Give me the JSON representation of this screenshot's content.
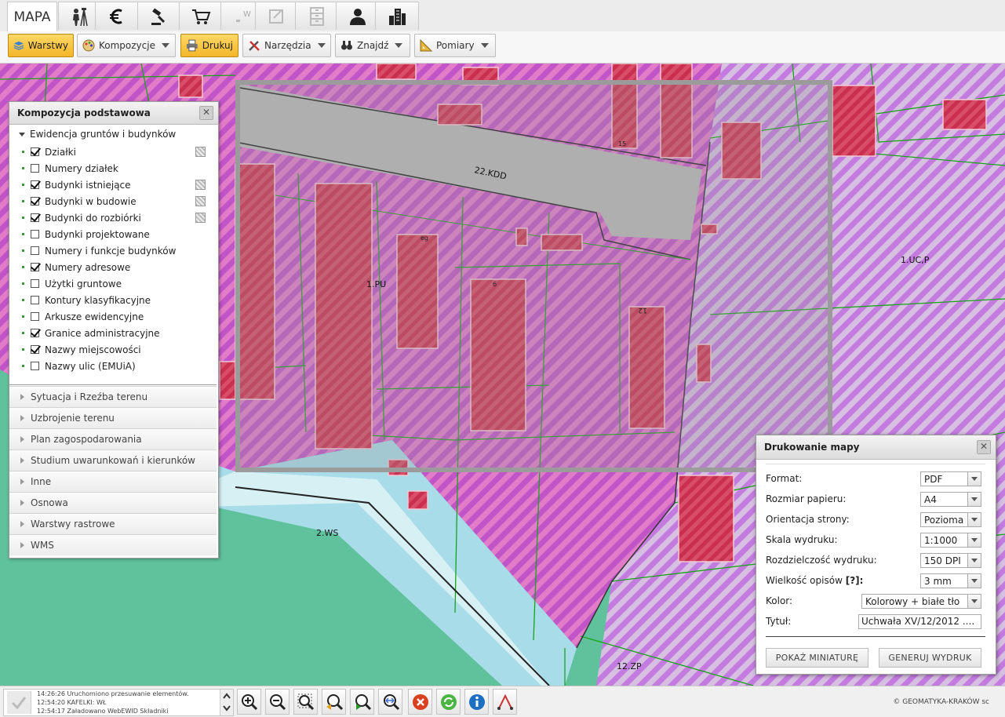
{
  "tabs": {
    "map_label": "MAPA"
  },
  "toolbar": {
    "warstwy": "Warstwy",
    "kompozycje": "Kompozycje",
    "drukuj": "Drukuj",
    "narzedzia": "Narzędzia",
    "znajdz": "Znajdź",
    "pomiary": "Pomiary"
  },
  "map": {
    "labels": [
      "22.KDD",
      "1.PU",
      "1.UC,P",
      "2.WS",
      "12.ZP",
      "12",
      "15",
      "eg",
      "6"
    ],
    "colors": {
      "zone_magenta": "#d65ad2",
      "zone_lilac": "#cf9be3",
      "water_green": "#63c4a0",
      "road_grey": "#b8b8b8",
      "building_red": "#c42b4f",
      "parcel_line": "#1aa31a"
    }
  },
  "layers_panel": {
    "title": "Kompozycja podstawowa",
    "group_title": "Ewidencja gruntów i budynków",
    "items": [
      {
        "label": "Działki",
        "checked": true,
        "legend": true
      },
      {
        "label": "Numery działek",
        "checked": false,
        "legend": false
      },
      {
        "label": "Budynki istniejące",
        "checked": true,
        "legend": true
      },
      {
        "label": "Budynki w budowie",
        "checked": true,
        "legend": true
      },
      {
        "label": "Budynki do rozbiórki",
        "checked": true,
        "legend": true
      },
      {
        "label": "Budynki projektowane",
        "checked": false,
        "legend": false
      },
      {
        "label": "Numery i funkcje budynków",
        "checked": false,
        "legend": false
      },
      {
        "label": "Numery adresowe",
        "checked": true,
        "legend": false
      },
      {
        "label": "Użytki gruntowe",
        "checked": false,
        "legend": false
      },
      {
        "label": "Kontury klasyfikacyjne",
        "checked": false,
        "legend": false
      },
      {
        "label": "Arkusze ewidencyjne",
        "checked": false,
        "legend": false
      },
      {
        "label": "Granice administracyjne",
        "checked": true,
        "legend": false
      },
      {
        "label": "Nazwy miejscowości",
        "checked": true,
        "legend": false
      },
      {
        "label": "Nazwy ulic (EMUiA)",
        "checked": false,
        "legend": false
      }
    ],
    "sections": [
      "Sytuacja i Rzeźba terenu",
      "Uzbrojenie terenu",
      "Plan zagospodarowania",
      "Studium uwarunkowań i kierunków",
      "Inne",
      "Osnowa",
      "Warstwy rastrowe",
      "WMS"
    ]
  },
  "print_dialog": {
    "title": "Drukowanie mapy",
    "fields": [
      {
        "label": "Format:",
        "value": "PDF"
      },
      {
        "label": "Rozmiar papieru:",
        "value": "A4"
      },
      {
        "label": "Orientacja strony:",
        "value": "Pozioma"
      },
      {
        "label": "Skala wydruku:",
        "value": "1:1000"
      },
      {
        "label": "Rozdzielczość wydruku:",
        "value": "150 DPI"
      },
      {
        "label": "Wielkość opisów",
        "help": "[?]:",
        "value": "3 mm"
      },
      {
        "label": "Kolor:",
        "value": "Kolorowy + białe tło"
      },
      {
        "label": "Tytuł:",
        "value": "Uchwała XV/12/2012 ...."
      }
    ],
    "preview_button": "POKAŻ MINIATURĘ",
    "generate_button": "GENERUJ WYDRUK"
  },
  "status": {
    "log": [
      "14:26:26 Uruchomiono przesuwanie elementów.",
      "12:54:20 KAFELKI: WŁ",
      "12:54:17 Załadowano WebEWID Składniki"
    ],
    "copyright": "© GEOMATYKA-KRAKÓW sc"
  }
}
